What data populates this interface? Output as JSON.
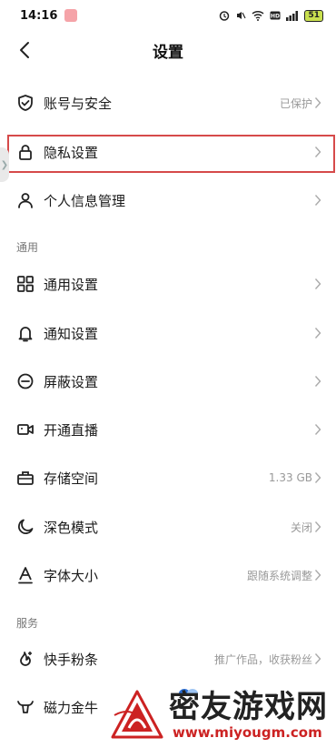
{
  "status_bar": {
    "time": "14:16",
    "battery": "51"
  },
  "nav": {
    "title": "设置"
  },
  "rows_group1": [
    {
      "icon": "shield-check-icon",
      "label": "账号与安全",
      "value": "已保护"
    },
    {
      "icon": "lock-icon",
      "label": "隐私设置",
      "value": ""
    },
    {
      "icon": "person-icon",
      "label": "个人信息管理",
      "value": ""
    }
  ],
  "section_general": "通用",
  "rows_general": [
    {
      "icon": "grid-icon",
      "label": "通用设置",
      "value": ""
    },
    {
      "icon": "bell-icon",
      "label": "通知设置",
      "value": ""
    },
    {
      "icon": "minus-circle-icon",
      "label": "屏蔽设置",
      "value": ""
    },
    {
      "icon": "video-camera-icon",
      "label": "开通直播",
      "value": ""
    },
    {
      "icon": "storage-box-icon",
      "label": "存储空间",
      "value": "1.33 GB"
    },
    {
      "icon": "moon-icon",
      "label": "深色模式",
      "value": "关闭"
    },
    {
      "icon": "font-size-icon",
      "label": "字体大小",
      "value": "跟随系统调整"
    }
  ],
  "section_services": "服务",
  "rows_services": [
    {
      "icon": "flame-plus-icon",
      "label": "快手粉条",
      "value": "推广作品，收获粉丝"
    },
    {
      "icon": "bull-icon",
      "label": "磁力金牛",
      "value": ""
    }
  ],
  "watermark": {
    "text": "密友游戏网",
    "url": "www.miyougm.com"
  },
  "colors": {
    "highlight_border": "#d64a4a",
    "watermark_red": "#cc2222"
  }
}
